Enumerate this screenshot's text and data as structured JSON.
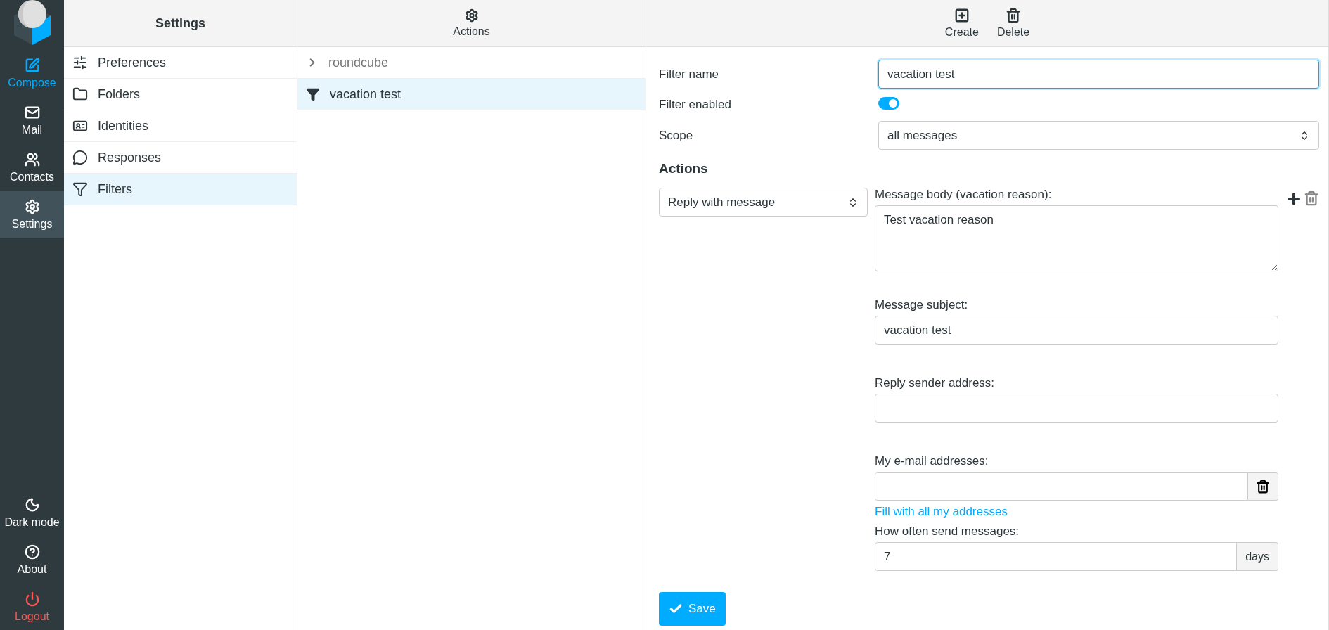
{
  "nav": {
    "top": [
      {
        "label": "Compose",
        "kind": "primary",
        "selected": false
      },
      {
        "label": "Mail",
        "kind": "normal",
        "selected": false
      },
      {
        "label": "Contacts",
        "kind": "normal",
        "selected": false
      },
      {
        "label": "Settings",
        "kind": "normal",
        "selected": true
      }
    ],
    "bottom": [
      {
        "label": "Dark mode",
        "kind": "normal",
        "selected": false
      },
      {
        "label": "About",
        "kind": "normal",
        "selected": false
      },
      {
        "label": "Logout",
        "kind": "danger",
        "selected": false
      }
    ]
  },
  "settings": {
    "title": "Settings",
    "items": [
      {
        "label": "Preferences",
        "selected": false
      },
      {
        "label": "Folders",
        "selected": false
      },
      {
        "label": "Identities",
        "selected": false
      },
      {
        "label": "Responses",
        "selected": false
      },
      {
        "label": "Filters",
        "selected": true
      }
    ]
  },
  "filters": {
    "toolbar": "Actions",
    "set": "roundcube",
    "items": [
      {
        "label": "vacation test",
        "selected": true
      }
    ]
  },
  "editor": {
    "toolbar": [
      "Create",
      "Delete"
    ],
    "filter_name": {
      "label": "Filter name",
      "value": "vacation test"
    },
    "filter_enabled": {
      "label": "Filter enabled",
      "on": true
    },
    "scope": {
      "label": "Scope",
      "value": "all messages"
    },
    "actions_heading": "Actions",
    "action": {
      "value": "Reply with message"
    },
    "message_body": {
      "label": "Message body (vacation reason):",
      "value": "Test vacation reason"
    },
    "message_subject": {
      "label": "Message subject:",
      "value": "vacation test"
    },
    "reply_sender": {
      "label": "Reply sender address:"
    },
    "my_addresses": {
      "label": "My e-mail addresses:",
      "link": "Fill with all my addresses"
    },
    "how_often": {
      "label": "How often send messages:",
      "value": "7",
      "unit": "days"
    },
    "save": "Save"
  }
}
